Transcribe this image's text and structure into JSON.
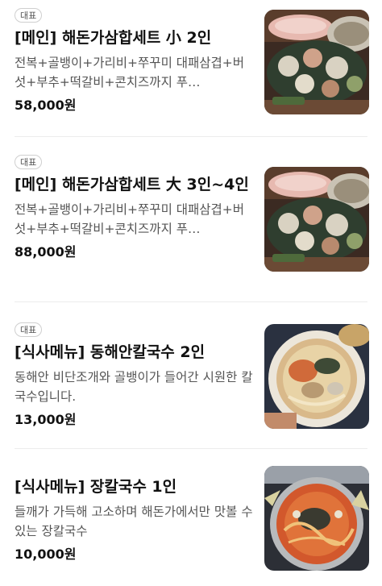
{
  "menu": {
    "items": [
      {
        "badge": "대표",
        "name": "[메인] 해돈가삼합세트 小 2인",
        "description": "전복+골뱅이+가리비+쭈꾸미 대패삼겹+버섯+부추+떡갈비+콘치즈까지 푸…",
        "price": "58,000원",
        "image": "seafood-pork-platter-photo"
      },
      {
        "badge": "대표",
        "name": "[메인] 해돈가삼합세트 大 3인~4인",
        "description": "전복+골뱅이+가리비+쭈꾸미 대패삼겹+버섯+부추+떡갈비+콘치즈까지 푸…",
        "price": "88,000원",
        "image": "seafood-pork-platter-photo"
      },
      {
        "badge": "대표",
        "name": "[식사메뉴] 동해안칼국수 2인",
        "description": "동해안 비단조개와 골뱅이가 들어간 시원한 칼국수입니다.",
        "price": "13,000원",
        "image": "clam-noodle-soup-photo"
      },
      {
        "badge": "",
        "name": "[식사메뉴] 장칼국수 1인",
        "description": "들깨가 가득해 고소하며 해돈가에서만 맛볼 수 있는 장칼국수",
        "price": "10,000원",
        "image": "spicy-noodle-soup-photo"
      }
    ]
  }
}
